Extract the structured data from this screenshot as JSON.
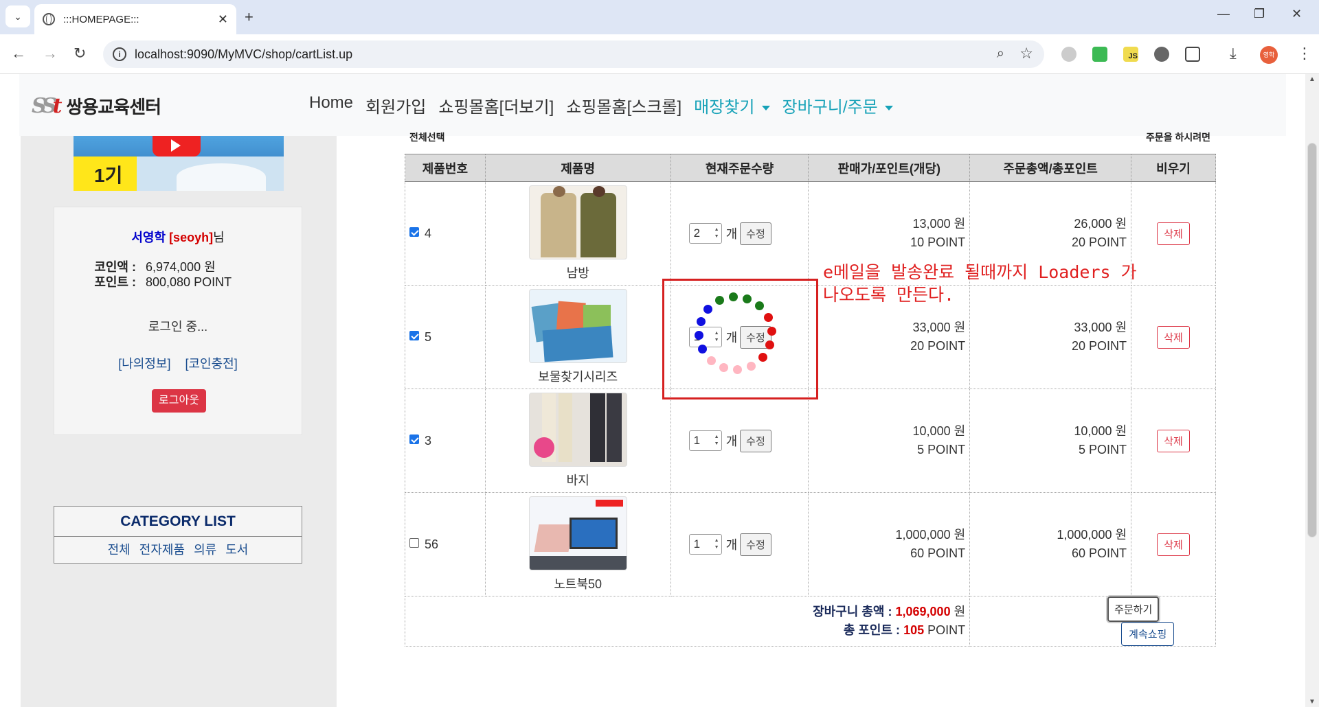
{
  "browser": {
    "tab_title": ":::HOMEPAGE:::",
    "url": "localhost:9090/MyMVC/shop/cartList.up",
    "profile_label": "영학",
    "js_ext_label": "JS"
  },
  "navbar": {
    "logo_mark_left": "SS",
    "logo_mark_right": "t",
    "logo_name": "쌍용교육센터",
    "menu": [
      "Home",
      "회원가입",
      "쇼핑몰홈[더보기]",
      "쇼핑몰홈[스크롤]"
    ],
    "dropdowns": [
      "매장찾기",
      "장바구니/주문"
    ]
  },
  "sidebar": {
    "banner_text": "1기",
    "user_name": "서영학",
    "user_id": "[seoyh]",
    "user_suffix": "님",
    "coin_label": "코인액 :",
    "coin_value": "6,974,000 원",
    "point_label": "포인트 :",
    "point_value": "800,080 POINT",
    "status": "로그인 중...",
    "links": [
      "[나의정보]",
      "[코인충전]"
    ],
    "logout": "로그아웃",
    "category_title": "CATEGORY LIST",
    "categories": [
      "전체",
      "전자제품",
      "의류",
      "도서"
    ]
  },
  "cart": {
    "top_left": "전체선택",
    "top_right": "주문을 하시려면",
    "headers": [
      "제품번호",
      "제품명",
      "현재주문수량",
      "판매가/포인트(개당)",
      "주문총액/총포인트",
      "비우기"
    ],
    "unit_label": "개",
    "edit_label": "수정",
    "delete_label": "삭제",
    "rows": [
      {
        "checked": true,
        "no": "4",
        "name": "남방",
        "qty": "2",
        "price": "13,000 원",
        "point": "10 POINT",
        "total": "26,000 원",
        "total_point": "20 POINT"
      },
      {
        "checked": true,
        "no": "5",
        "name": "보물찾기시리즈",
        "qty": "1",
        "price": "33,000 원",
        "point": "20 POINT",
        "total": "33,000 원",
        "total_point": "20 POINT"
      },
      {
        "checked": true,
        "no": "3",
        "name": "바지",
        "qty": "1",
        "price": "10,000 원",
        "point": "5 POINT",
        "total": "10,000 원",
        "total_point": "5 POINT"
      },
      {
        "checked": false,
        "no": "56",
        "name": "노트북50",
        "qty": "1",
        "price": "1,000,000 원",
        "point": "60 POINT",
        "total": "1,000,000 원",
        "total_point": "60 POINT"
      }
    ],
    "sum_label": "장바구니 총액 :",
    "sum_value": "1,069,000",
    "sum_unit": "원",
    "total_point_label": "총 포인트 :",
    "total_point_value": "105",
    "total_point_unit": "POINT",
    "order_button": "주문하기",
    "continue_button": "계속쇼핑"
  },
  "annotation": {
    "text": "e메일을 발송완료 될때까지 Loaders 가\n나오도록 만든다.",
    "color": "#e02020"
  },
  "spinner_colors": [
    "#1a7a1a",
    "#1a7a1a",
    "#1a7a1a",
    "#1a7a1a",
    "#e01010",
    "#e01010",
    "#e01010",
    "#e01010",
    "#ffb6c1",
    "#ffb6c1",
    "#ffb6c1",
    "#ffb6c1",
    "#1010e0",
    "#1010e0",
    "#1010e0",
    "#1010e0"
  ]
}
